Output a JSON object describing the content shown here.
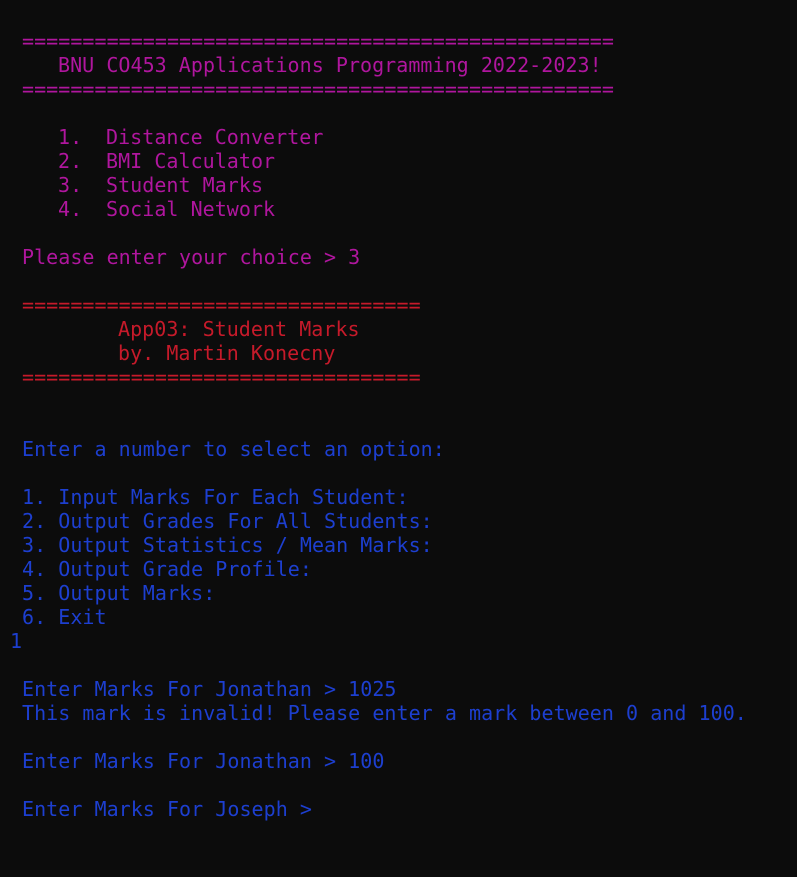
{
  "palette": {
    "background": "#0c0c0c",
    "magenta": "#b0169e",
    "red": "#c61a2a",
    "blue": "#1d3fd0"
  },
  "main_menu": {
    "rule": "=================================================",
    "title": "BNU CO453 Applications Programming 2022-2023!",
    "options": [
      {
        "number": "1.",
        "label": "Distance Converter"
      },
      {
        "number": "2.",
        "label": "BMI Calculator"
      },
      {
        "number": "3.",
        "label": "Student Marks"
      },
      {
        "number": "4.",
        "label": "Social Network"
      }
    ],
    "choice_prompt": "Please enter your choice > 3"
  },
  "app_header": {
    "rule": "=================================",
    "title": "App03: Student Marks",
    "author": "by. Martin Konecny"
  },
  "student_marks": {
    "select_prompt": "Enter a number to select an option:",
    "options": [
      "1. Input Marks For Each Student:",
      "2. Output Grades For All Students:",
      "3. Output Statistics / Mean Marks:",
      "4. Output Grade Profile:",
      "5. Output Marks:",
      "6. Exit"
    ],
    "user_selection": "1",
    "log": [
      "Enter Marks For Jonathan > 1025",
      "This mark is invalid! Please enter a mark between 0 and 100.",
      "Enter Marks For Jonathan > 100",
      "Enter Marks For Joseph >"
    ]
  }
}
